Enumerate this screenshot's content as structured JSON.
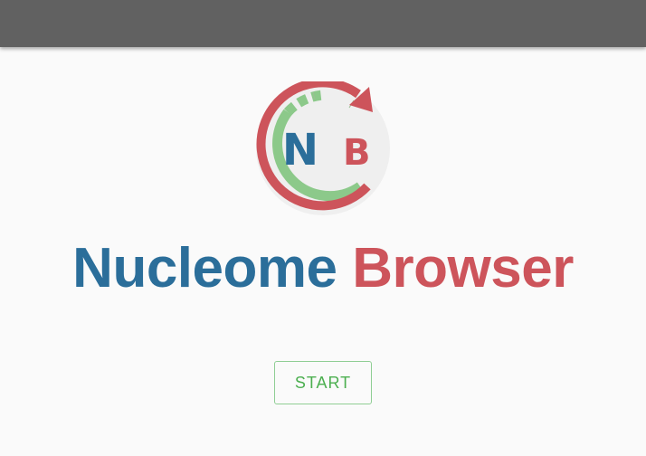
{
  "app_bar": {
    "color": "#616161"
  },
  "logo": {
    "initial_1": "N",
    "initial_2": "B",
    "icon": "nucleome-browser-logo"
  },
  "title": {
    "part_1": "Nucleome",
    "part_2": "Browser"
  },
  "start_button": {
    "label": "START"
  },
  "colors": {
    "blue": "#2b6e9a",
    "red": "#cd545b",
    "green": "#4caf50",
    "light_green": "#8cc98a"
  }
}
